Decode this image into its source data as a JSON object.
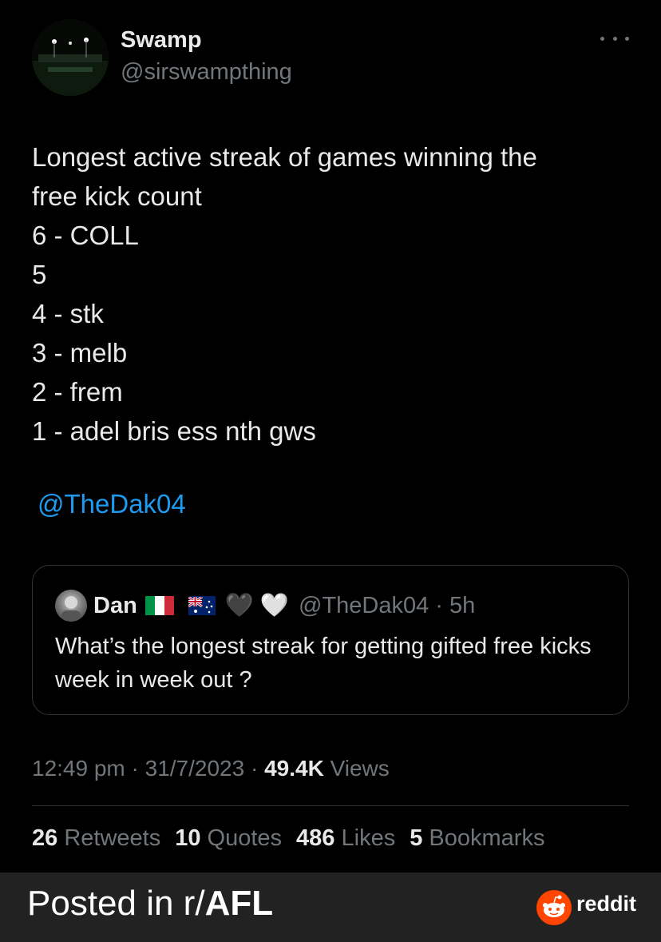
{
  "tweet": {
    "author_name": "Swamp",
    "author_handle": "@sirswampthing",
    "body_lines": [
      "Longest active streak of games winning the",
      "free kick count",
      "6 - COLL",
      "5",
      "4 - stk",
      "3 - melb",
      "2 - frem",
      "1 - adel bris ess nth gws"
    ],
    "mention": "@TheDak04",
    "quote": {
      "name": "Dan",
      "flag1": "italy-flag-icon",
      "flag2": "australia-flag-icon",
      "heart1": "🖤",
      "heart2": "🤍",
      "handle_time": "@TheDak04 · 5h",
      "text": "What’s the longest streak for getting gifted free kicks week in week out ?"
    },
    "timestamp": "12:49 pm · 31/7/2023 · ",
    "views_count": "49.4K",
    "views_label": " Views",
    "stats": [
      {
        "count": "26",
        "label": " Retweets"
      },
      {
        "count": "10",
        "label": " Quotes"
      },
      {
        "count": "486",
        "label": " Likes"
      },
      {
        "count": "5",
        "label": " Bookmarks"
      }
    ]
  },
  "footer": {
    "posted_prefix": "Posted in r/",
    "subreddit": "AFL",
    "brand": "reddit"
  },
  "colors": {
    "background": "#000000",
    "text": "#e7e9ea",
    "muted": "#71767b",
    "link": "#1d9bf0",
    "border": "#2f3336",
    "footer_bg": "#222222",
    "reddit_orange": "#ff4500"
  }
}
